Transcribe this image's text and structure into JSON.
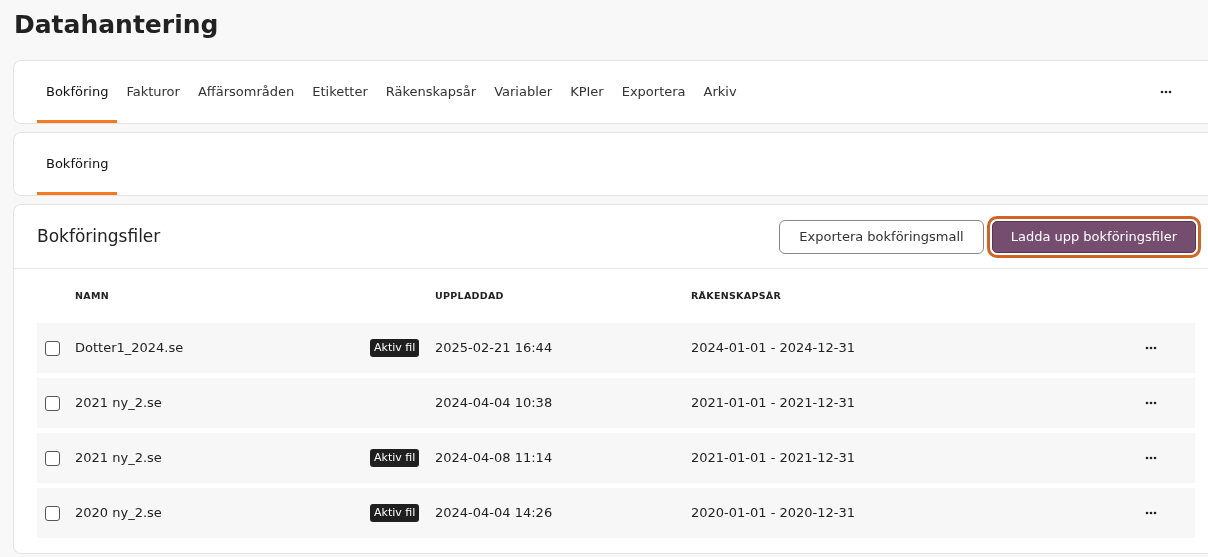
{
  "page_title": "Datahantering",
  "tabs": [
    {
      "label": "Bokföring",
      "selected": true
    },
    {
      "label": "Fakturor",
      "selected": false
    },
    {
      "label": "Affärsområden",
      "selected": false
    },
    {
      "label": "Etiketter",
      "selected": false
    },
    {
      "label": "Räkenskapsår",
      "selected": false
    },
    {
      "label": "Variabler",
      "selected": false
    },
    {
      "label": "KPIer",
      "selected": false
    },
    {
      "label": "Exportera",
      "selected": false
    },
    {
      "label": "Arkiv",
      "selected": false
    }
  ],
  "sub_tabs": [
    {
      "label": "Bokföring",
      "selected": true
    }
  ],
  "files_panel": {
    "title": "Bokföringsfiler",
    "buttons": [
      {
        "label": "Exportera bokföringsmall",
        "kind": "outline",
        "highlighted": false
      },
      {
        "label": "Ladda upp bokföringsfiler",
        "kind": "primary",
        "highlighted": true
      }
    ],
    "table": {
      "columns": [
        "NAMN",
        "UPPLADDAD",
        "RÄKENSKAPSÅR"
      ],
      "rows": [
        {
          "checked": false,
          "name": "Dotter1_2024.se",
          "badge": "Aktiv fil",
          "uploaded": "2025-02-21 16:44",
          "fiscal_year": "2024-01-01 - 2024-12-31"
        },
        {
          "checked": false,
          "name": "2021 ny_2.se",
          "uploaded": "2024-04-04 10:38",
          "fiscal_year": "2021-01-01 - 2021-12-31"
        },
        {
          "checked": false,
          "name": "2021 ny_2.se",
          "badge": "Aktiv fil",
          "uploaded": "2024-04-08 11:14",
          "fiscal_year": "2021-01-01 - 2021-12-31"
        },
        {
          "checked": false,
          "name": "2020 ny_2.se",
          "badge": "Aktiv fil",
          "uploaded": "2024-04-04 14:26",
          "fiscal_year": "2020-01-01 - 2020-12-31"
        }
      ]
    }
  }
}
